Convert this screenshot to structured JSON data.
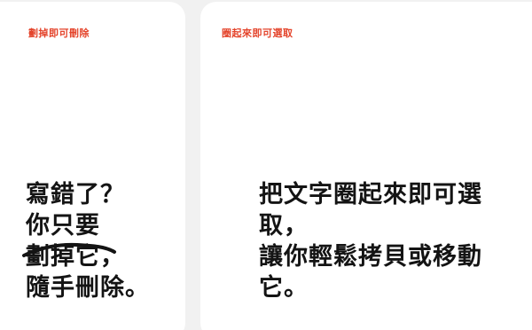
{
  "cards": [
    {
      "tag": "劃掉即可刪除",
      "lines": [
        "寫錯了？",
        "你只要",
        "劃掉它，",
        "隨手刪除。"
      ],
      "strike_target": "劃掉它"
    },
    {
      "tag": "圈起來即可選取",
      "lines": [
        "把文字圈起來即可選",
        "取，",
        "讓你輕鬆拷貝或移動",
        "它。"
      ]
    }
  ],
  "colors": {
    "tag": "#e4442b",
    "text": "#141414",
    "card_bg": "#ffffff",
    "page_bg": "#f1f1f1"
  }
}
